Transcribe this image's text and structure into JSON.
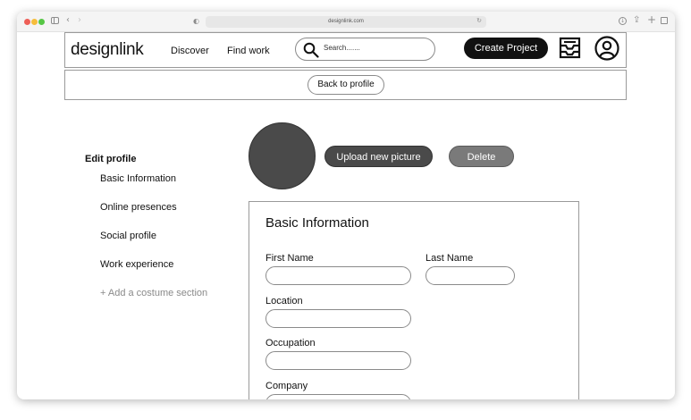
{
  "browser": {
    "url": "designlink.com"
  },
  "nav": {
    "logo": "designlink",
    "links": [
      "Discover",
      "Find work"
    ],
    "search_placeholder": "Search.......",
    "create_button": "Create Project"
  },
  "subbar": {
    "back_button": "Back to profile"
  },
  "sidebar": {
    "title": "Edit profile",
    "items": [
      "Basic Information",
      "Online presences",
      "Social profile",
      "Work experience"
    ],
    "add_section": "+ Add a costume section"
  },
  "profile_picture": {
    "upload_button": "Upload new picture",
    "delete_button": "Delete"
  },
  "form": {
    "title": "Basic Information",
    "fields": {
      "first_name": {
        "label": "First Name",
        "value": ""
      },
      "last_name": {
        "label": "Last Name",
        "value": ""
      },
      "location": {
        "label": "Location",
        "value": ""
      },
      "occupation": {
        "label": "Occupation",
        "value": ""
      },
      "company": {
        "label": "Company",
        "value": ""
      }
    }
  },
  "icons": {
    "search": "search-icon",
    "inbox": "inbox-tray-icon",
    "profile": "user-circle-icon"
  },
  "colors": {
    "primary_button": "#111111",
    "upload_button": "#4a4a4a",
    "delete_button": "#7a7a7a",
    "avatar": "#4a4a4a"
  }
}
